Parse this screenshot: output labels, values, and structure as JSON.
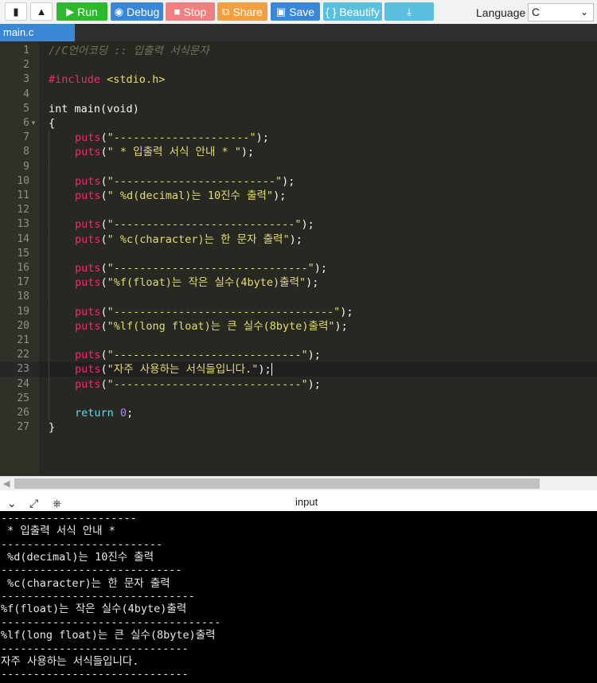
{
  "toolbar": {
    "run_label": "Run",
    "debug_label": "Debug",
    "stop_label": "Stop",
    "share_label": "Share",
    "save_label": "Save",
    "beautify_label": "{ } Beautify",
    "language_label": "Language",
    "language_value": "C",
    "colors": {
      "run": "#2eb82e",
      "debug": "#3a87d6",
      "stop": "#f08080",
      "share": "#f0a040",
      "save": "#3a87d6",
      "beautify": "#5bc0de",
      "download": "#5bc0de"
    },
    "icons": [
      "new-file-icon",
      "upload-icon",
      "play-icon",
      "debug-icon",
      "stop-icon",
      "share-icon",
      "save-icon",
      "download-icon",
      "chevron-down-icon"
    ]
  },
  "tab": {
    "label": "main.c"
  },
  "editor": {
    "lines": [
      {
        "n": "1",
        "text": "//C언어코딩 :: 입출력 서식문자"
      },
      {
        "n": "2",
        "text": ""
      },
      {
        "n": "3",
        "text": "#include <stdio.h>"
      },
      {
        "n": "4",
        "text": ""
      },
      {
        "n": "5",
        "text": "int main(void)"
      },
      {
        "n": "6",
        "text": "{"
      },
      {
        "n": "7",
        "text": "puts(\"---------------------\");"
      },
      {
        "n": "8",
        "text": "puts(\" * 입출력 서식 안내 * \");"
      },
      {
        "n": "9",
        "text": ""
      },
      {
        "n": "10",
        "text": "puts(\"-------------------------\");"
      },
      {
        "n": "11",
        "text": "puts(\" %d(decimal)는 10진수 출력\");"
      },
      {
        "n": "12",
        "text": ""
      },
      {
        "n": "13",
        "text": "puts(\"----------------------------\");"
      },
      {
        "n": "14",
        "text": "puts(\" %c(character)는 한 문자 출력\");"
      },
      {
        "n": "15",
        "text": ""
      },
      {
        "n": "16",
        "text": "puts(\"------------------------------\");"
      },
      {
        "n": "17",
        "text": "puts(\"%f(float)는 작은 실수(4byte)출력\");"
      },
      {
        "n": "18",
        "text": ""
      },
      {
        "n": "19",
        "text": "puts(\"----------------------------------\");"
      },
      {
        "n": "20",
        "text": "puts(\"%lf(long float)는 큰 실수(8byte)출력\");"
      },
      {
        "n": "21",
        "text": ""
      },
      {
        "n": "22",
        "text": "puts(\"-----------------------------\");"
      },
      {
        "n": "23",
        "text": "puts(\"자주 사용하는 서식들입니다.\");"
      },
      {
        "n": "24",
        "text": "puts(\"-----------------------------\");"
      },
      {
        "n": "25",
        "text": ""
      },
      {
        "n": "26",
        "text": "return 0;"
      },
      {
        "n": "27",
        "text": "}"
      }
    ]
  },
  "console": {
    "title": "input",
    "icons": [
      "chevron-down-icon",
      "expand-icon",
      "clear-console-icon"
    ],
    "output": [
      "---------------------",
      " * 입출력 서식 안내 * ",
      "-------------------------",
      " %d(decimal)는 10진수 출력",
      "----------------------------",
      " %c(character)는 한 문자 출력",
      "------------------------------",
      "%f(float)는 작은 실수(4byte)출력",
      "----------------------------------",
      "%lf(long float)는 큰 실수(8byte)출력",
      "-----------------------------",
      "자주 사용하는 서식들입니다.",
      "-----------------------------"
    ]
  }
}
